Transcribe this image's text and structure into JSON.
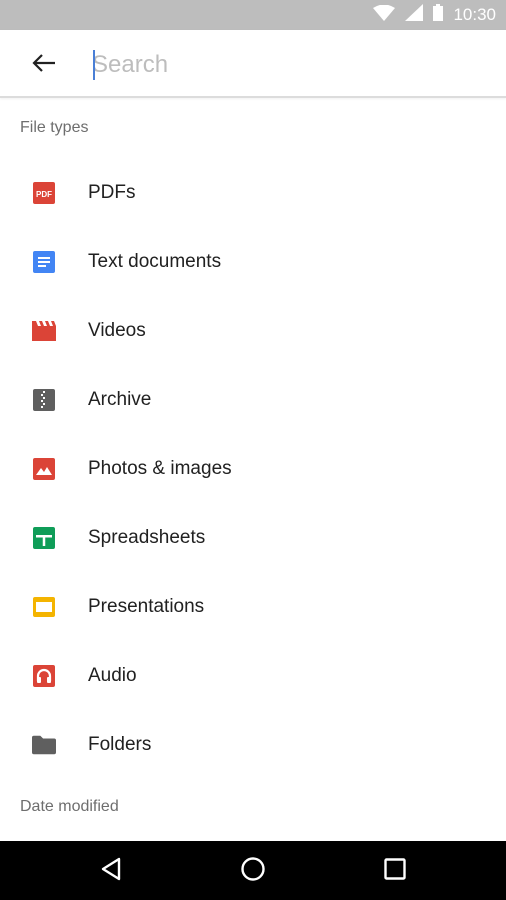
{
  "status_bar": {
    "time": "10:30",
    "icons": [
      "wifi-icon",
      "cell-signal-icon",
      "battery-icon"
    ]
  },
  "search": {
    "placeholder": "Search",
    "value": "",
    "back_icon": "arrow-back-icon"
  },
  "sections": {
    "file_types": "File types",
    "date_modified": "Date modified"
  },
  "file_types": [
    {
      "label": "PDFs",
      "icon": "pdf-icon",
      "color": "#db4437"
    },
    {
      "label": "Text documents",
      "icon": "text-document-icon",
      "color": "#4285f4"
    },
    {
      "label": "Videos",
      "icon": "video-icon",
      "color": "#db4437"
    },
    {
      "label": "Archive",
      "icon": "archive-icon",
      "color": "#5f5f5f"
    },
    {
      "label": "Photos & images",
      "icon": "image-icon",
      "color": "#db4437"
    },
    {
      "label": "Spreadsheets",
      "icon": "spreadsheet-icon",
      "color": "#0f9d58"
    },
    {
      "label": "Presentations",
      "icon": "presentation-icon",
      "color": "#f4b400"
    },
    {
      "label": "Audio",
      "icon": "audio-icon",
      "color": "#db4437"
    },
    {
      "label": "Folders",
      "icon": "folder-icon",
      "color": "#5f5f5f"
    }
  ],
  "nav_bar": {
    "buttons": [
      "back-nav-icon",
      "home-nav-icon",
      "recents-nav-icon"
    ]
  }
}
